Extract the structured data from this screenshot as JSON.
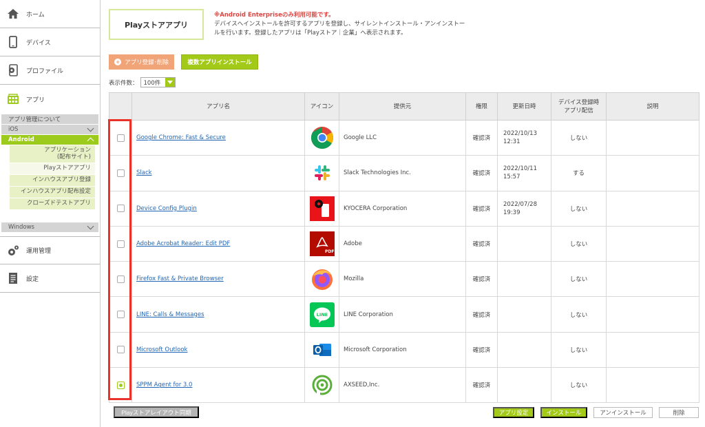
{
  "sidebar": {
    "home": "ホーム",
    "devices": "デバイス",
    "profile": "プロファイル",
    "apps": "アプリ",
    "about": "アプリ管理について",
    "ios": "iOS",
    "android": "Android",
    "android_items": [
      "アプリケーション\n(配布サイト)",
      "Playストアアプリ",
      "インハウスアプリ登録",
      "インハウスアプリ配布設定",
      "クローズドテストアプリ"
    ],
    "windows": "Windows",
    "ops": "運用管理",
    "settings": "設定"
  },
  "page": {
    "title": "Playストアアプリ",
    "notice_warn": "※Android Enterpriseのみ利用可能です。",
    "notice_text": "デバイスへインストールを許可するアプリを登録し、サイレントインストール・アンインストールを行います。登録したアプリは「Playストア｜企業」へ表示されます。",
    "register_button": "アプリ登録･削除",
    "multi_install_button": "複数アプリインストール",
    "count_label": "表示件数：",
    "count_value": "100件"
  },
  "table": {
    "headers": {
      "name": "アプリ名",
      "icon": "アイコン",
      "vendor": "提供元",
      "perm": "権限",
      "updated": "更新日時",
      "dist_l1": "デバイス登録時",
      "dist_l2": "アプリ配信",
      "desc": "説明"
    },
    "rows": [
      {
        "name": "Google Chrome: Fast & Secure",
        "icon": "chrome-icon",
        "vendor": "Google LLC",
        "perm": "確認済",
        "date1": "2022/10/13",
        "date2": "12:31",
        "dist": "しない",
        "checked": false
      },
      {
        "name": "Slack",
        "icon": "slack-icon",
        "vendor": "Slack Technologies Inc.",
        "perm": "確認済",
        "date1": "2022/10/11",
        "date2": "15:57",
        "dist": "する",
        "checked": false
      },
      {
        "name": "Device Config Plugin",
        "icon": "kyocera-config-icon",
        "vendor": "KYOCERA Corporation",
        "perm": "確認済",
        "date1": "2022/07/28",
        "date2": "19:39",
        "dist": "しない",
        "checked": false
      },
      {
        "name": "Adobe Acrobat Reader: Edit PDF",
        "icon": "acrobat-icon",
        "vendor": "Adobe",
        "perm": "確認済",
        "date1": "",
        "date2": "",
        "dist": "しない",
        "checked": false
      },
      {
        "name": "Firefox Fast & Private Browser",
        "icon": "firefox-icon",
        "vendor": "Mozilla",
        "perm": "確認済",
        "date1": "",
        "date2": "",
        "dist": "しない",
        "checked": false
      },
      {
        "name": "LINE: Calls & Messages",
        "icon": "line-icon",
        "vendor": "LINE Corporation",
        "perm": "確認済",
        "date1": "",
        "date2": "",
        "dist": "しない",
        "checked": false
      },
      {
        "name": "Microsoft Outlook",
        "icon": "outlook-icon",
        "vendor": "Microsoft Corporation",
        "perm": "確認済",
        "date1": "",
        "date2": "",
        "dist": "しない",
        "checked": false
      },
      {
        "name": "SPPM Agent for 3.0",
        "icon": "sppm-icon",
        "vendor": "AXSEED,Inc.",
        "perm": "確認済",
        "date1": "",
        "date2": "",
        "dist": "しない",
        "checked": true
      }
    ]
  },
  "footer": {
    "sync_button": "Playストアレイアウト同期",
    "app_settings_button": "アプリ設定",
    "install_button": "インストール",
    "uninstall_button": "アンインストール",
    "delete_button": "削除"
  },
  "colors": {
    "accent_green": "#a3c919",
    "warn_red": "#e0433f",
    "highlight_red": "#e8322a",
    "register_orange": "#f0a478"
  }
}
